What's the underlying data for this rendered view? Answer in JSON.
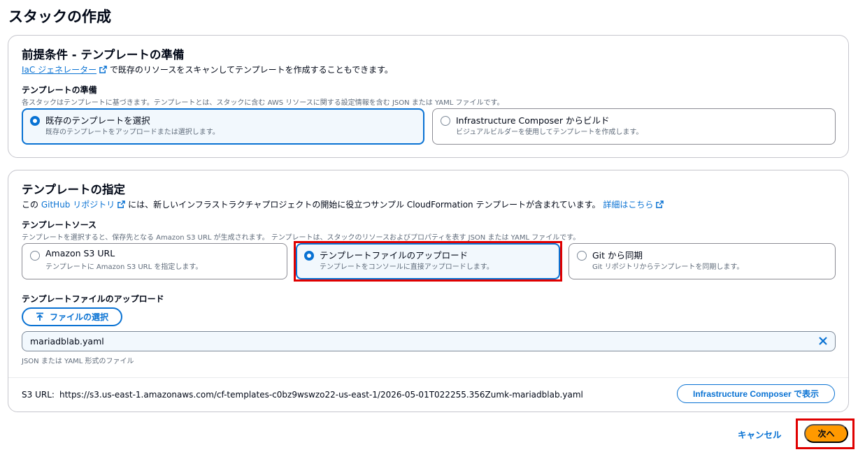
{
  "page": {
    "title": "スタックの作成"
  },
  "prerequisite": {
    "title": "前提条件 - テンプレートの準備",
    "iac_link": "IaC ジェネレーター",
    "iac_text": "で既存のリソースをスキャンしてテンプレートを作成することもできます。",
    "field_label": "テンプレートの準備",
    "field_desc": "各スタックはテンプレートに基づきます。テンプレートとは、スタックに含む AWS リソースに関する設定情報を含む JSON または YAML ファイルです。",
    "options": [
      {
        "title": "既存のテンプレートを選択",
        "sub": "既存のテンプレートをアップロードまたは選択します。",
        "selected": true
      },
      {
        "title": "Infrastructure Composer からビルド",
        "sub": "ビジュアルビルダーを使用してテンプレートを作成します。",
        "selected": false
      }
    ]
  },
  "specify": {
    "title": "テンプレートの指定",
    "desc_prefix": "この",
    "github_link": "GitHub リポジトリ",
    "desc_middle": "には、新しいインフラストラクチャプロジェクトの開始に役立つサンプル CloudFormation テンプレートが含まれています。",
    "details_link": "詳細はこちら",
    "source_label": "テンプレートソース",
    "source_desc": "テンプレートを選択すると、保存先となる Amazon S3 URL が生成されます。 テンプレートは、スタックのリソースおよびプロパティを表す JSON または YAML ファイルです。",
    "sources": [
      {
        "title": "Amazon S3 URL",
        "sub": "テンプレートに Amazon S3 URL を指定します。",
        "selected": false
      },
      {
        "title": "テンプレートファイルのアップロード",
        "sub": "テンプレートをコンソールに直接アップロードします。",
        "selected": true
      },
      {
        "title": "Git から同期",
        "sub": "Git リポジトリからテンプレートを同期します。",
        "selected": false
      }
    ],
    "upload_label": "テンプレートファイルのアップロード",
    "choose_file_label": "ファイルの選択",
    "file_value": "mariadblab.yaml",
    "file_hint": "JSON または YAML 形式のファイル",
    "s3_label": "S3 URL:",
    "s3_url": "https://s3.us-east-1.amazonaws.com/cf-templates-c0bz9wswzo22-us-east-1/2026-05-01T022255.356Zumk-mariadblab.yaml",
    "composer_button": "Infrastructure Composer で表示"
  },
  "footer": {
    "cancel_label": "キャンセル",
    "next_label": "次へ"
  },
  "colors": {
    "accent": "#0972d3",
    "primary_button": "#ff9900",
    "highlight": "#e00000"
  }
}
